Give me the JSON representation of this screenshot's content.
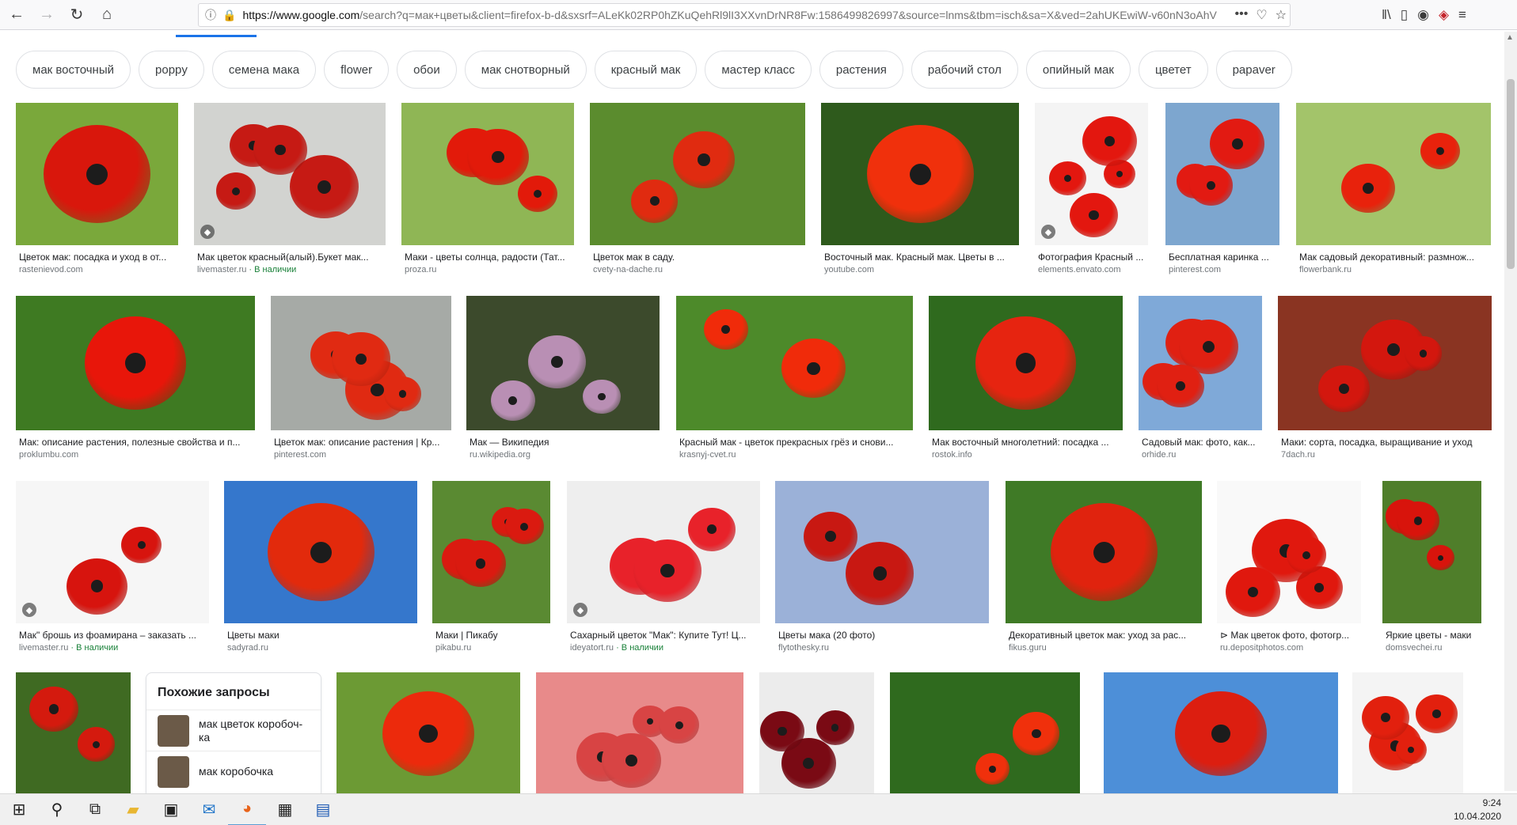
{
  "browser": {
    "url_host": "https://www.google.com",
    "url_rest": "/search?q=мак+цветы&client=firefox-b-d&sxsrf=ALeKk02RP0hZKuQehRl9lI3XXvnDrNR8Fw:1586499826997&source=lnms&tbm=isch&sa=X&ved=2ahUKEwiW-v60nN3oAhV",
    "url_more": "•••",
    "nav": {
      "back": "←",
      "forward": "→",
      "reload": "↻",
      "home": "⌂"
    },
    "icons": {
      "info": "ⓘ",
      "lock": "🔒",
      "pocket": "♡",
      "star": "☆",
      "library": "‖\\",
      "sidebar": "▯",
      "account": "◉",
      "ublock": "◈",
      "menu": "≡"
    }
  },
  "chips": [
    "мак восточный",
    "poppy",
    "семена мака",
    "flower",
    "обои",
    "мак снотворный",
    "красный мак",
    "мастер класс",
    "растения",
    "рабочий стол",
    "опийный мак",
    "цветет",
    "papaver"
  ],
  "images": [
    {
      "caption": "Цветок мак: посадка и уход в от...",
      "source": "rastenievod.com",
      "avail": "",
      "tag": false,
      "palette": [
        "#7aa83b",
        "#d9170c"
      ]
    },
    {
      "caption": "Мак цветок красный(алый).Букет мак...",
      "source": "livemaster.ru",
      "avail": " · В наличии",
      "tag": true,
      "palette": [
        "#d2d3d0",
        "#c61a14"
      ]
    },
    {
      "caption": "Маки - цветы солнца, радости (Тат...",
      "source": "proza.ru",
      "avail": "",
      "tag": false,
      "palette": [
        "#8fb655",
        "#e21a0a"
      ]
    },
    {
      "caption": "Цветок мак в саду.",
      "source": "cvety-na-dache.ru",
      "avail": "",
      "tag": false,
      "palette": [
        "#5b8c2e",
        "#e02b10"
      ]
    },
    {
      "caption": "Восточный мак. Красный мак. Цветы в ...",
      "source": "youtube.com",
      "avail": "",
      "tag": false,
      "palette": [
        "#2e5a1c",
        "#f0300c"
      ]
    },
    {
      "caption": "Фотография Красный ...",
      "source": "elements.envato.com",
      "avail": "",
      "tag": true,
      "palette": [
        "#f4f4f4",
        "#e3170f"
      ]
    },
    {
      "caption": "Бесплатная каринка ...",
      "source": "pinterest.com",
      "avail": "",
      "tag": false,
      "palette": [
        "#7da6cf",
        "#e21a12"
      ]
    },
    {
      "caption": "Мак садовый декоративный: размнож...",
      "source": "flowerbank.ru",
      "avail": "",
      "tag": false,
      "palette": [
        "#a3c46a",
        "#e8220c"
      ]
    },
    {
      "caption": "Мак: описание растения, полезные свойства и п...",
      "source": "proklumbu.com",
      "avail": "",
      "tag": false,
      "palette": [
        "#3e7a22",
        "#e8160a"
      ]
    },
    {
      "caption": "Цветок мак: описание растения | Кр...",
      "source": "pinterest.com",
      "avail": "",
      "tag": false,
      "palette": [
        "#a6aaa6",
        "#e02a12"
      ]
    },
    {
      "caption": "Мак — Википедия",
      "source": "ru.wikipedia.org",
      "avail": "",
      "tag": false,
      "palette": [
        "#3c4a2c",
        "#b98fb4"
      ]
    },
    {
      "caption": "Красный мак - цветок прекрасных грёз и снови...",
      "source": "krasnyj-cvet.ru",
      "avail": "",
      "tag": false,
      "palette": [
        "#4d8a2a",
        "#f02b0a"
      ]
    },
    {
      "caption": "Мак восточный многолетний: посадка ...",
      "source": "rostok.info",
      "avail": "",
      "tag": false,
      "palette": [
        "#2f6a1e",
        "#e62410"
      ]
    },
    {
      "caption": "Садовый мак: фото, как...",
      "source": "orhide.ru",
      "avail": "",
      "tag": false,
      "palette": [
        "#7fa9d8",
        "#e02012"
      ]
    },
    {
      "caption": "Маки: сорта, посадка, выращивание и уход",
      "source": "7dach.ru",
      "avail": "",
      "tag": false,
      "palette": [
        "#8a3422",
        "#d3170e"
      ]
    },
    {
      "caption": "Мак\" брошь из фоамирана – заказать ...",
      "source": "livemaster.ru",
      "avail": " · В наличии",
      "tag": true,
      "palette": [
        "#f6f6f6",
        "#d7140e"
      ]
    },
    {
      "caption": "Цветы маки",
      "source": "sadyrad.ru",
      "avail": "",
      "tag": false,
      "palette": [
        "#3577cc",
        "#e22a0c"
      ]
    },
    {
      "caption": "Маки | Пикабу",
      "source": "pikabu.ru",
      "avail": "",
      "tag": false,
      "palette": [
        "#5a8a32",
        "#da1a10"
      ]
    },
    {
      "caption": "Сахарный цветок \"Мак\": Купите Тут! Ц...",
      "source": "ideyatort.ru",
      "avail": " · В наличии",
      "tag": true,
      "palette": [
        "#eeeeee",
        "#e8222a"
      ]
    },
    {
      "caption": "Цветы мака (20 фото)",
      "source": "flytothesky.ru",
      "avail": "",
      "tag": false,
      "palette": [
        "#9bb1d8",
        "#c81812"
      ]
    },
    {
      "caption": "Декоративный цветок мак: уход за рас...",
      "source": "fikus.guru",
      "avail": "",
      "tag": false,
      "palette": [
        "#3f7a26",
        "#e0230e"
      ]
    },
    {
      "caption": "⊳ Мак цветок фото, фотогр...",
      "source": "ru.depositphotos.com",
      "avail": "",
      "tag": false,
      "palette": [
        "#f9f9f9",
        "#e0180e"
      ]
    },
    {
      "caption": "Яркие цветы - маки",
      "source": "domsvechei.ru",
      "avail": "",
      "tag": false,
      "palette": [
        "#4f7e2a",
        "#d8140c"
      ]
    },
    {
      "caption": "",
      "source": "",
      "avail": "",
      "tag": false,
      "palette": [
        "#3f6a22",
        "#d41a0e"
      ]
    },
    {
      "caption": "",
      "source": "",
      "avail": "",
      "tag": false,
      "palette": [
        "#6c9a34",
        "#ec2a0c"
      ]
    },
    {
      "caption": "",
      "source": "",
      "avail": "",
      "tag": false,
      "palette": [
        "#e88a8a",
        "#d84444"
      ]
    },
    {
      "caption": "",
      "source": "",
      "avail": "",
      "tag": false,
      "palette": [
        "#ececec",
        "#7a0a14"
      ]
    },
    {
      "caption": "",
      "source": "",
      "avail": "",
      "tag": false,
      "palette": [
        "#2f6a1e",
        "#f0300c"
      ]
    },
    {
      "caption": "",
      "source": "",
      "avail": "",
      "tag": false,
      "palette": [
        "#4d8fd8",
        "#dc1e10"
      ]
    },
    {
      "caption": "",
      "source": "",
      "avail": "",
      "tag": false,
      "palette": [
        "#f4f4f4",
        "#e2200e"
      ]
    }
  ],
  "related": {
    "title": "Похожие запросы",
    "items": [
      {
        "label": "мак цветок коробоч-ка"
      },
      {
        "label": "мак коробочка"
      }
    ]
  },
  "taskbar": {
    "time": "9:24",
    "date": "10.04.2020",
    "icons": {
      "start": "⊞",
      "search": "⚲",
      "task_view": "⧉",
      "explorer": "▰",
      "store": "▣",
      "mail": "✉",
      "firefox": "◕",
      "app1": "▦",
      "app2": "▤"
    }
  }
}
